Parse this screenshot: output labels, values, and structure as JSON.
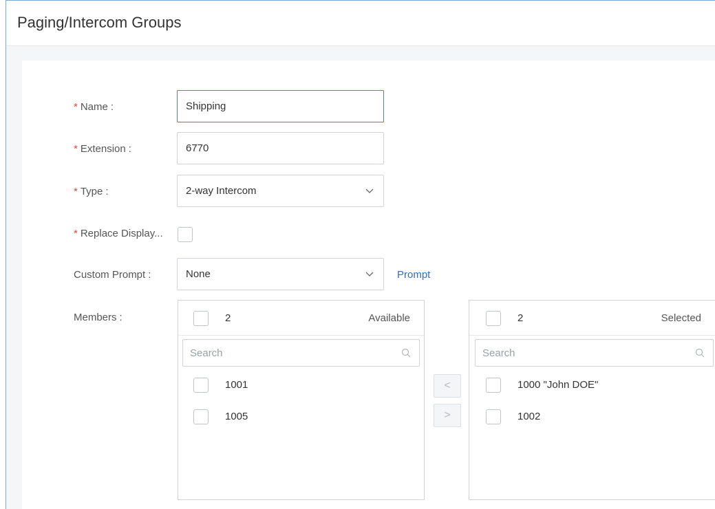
{
  "page": {
    "title": "Paging/Intercom Groups"
  },
  "form": {
    "name": {
      "label": "Name",
      "value": "Shipping",
      "required": true
    },
    "extension": {
      "label": "Extension",
      "value": "6770",
      "required": true
    },
    "type": {
      "label": "Type",
      "value": "2-way Intercom",
      "required": true
    },
    "replace_display": {
      "label": "Replace Display...",
      "required": true,
      "checked": false
    },
    "custom_prompt": {
      "label": "Custom Prompt",
      "value": "None",
      "link": "Prompt"
    },
    "members": {
      "label": "Members"
    }
  },
  "colon": ":",
  "required_mark": "*",
  "transfer": {
    "available": {
      "count": "2",
      "title": "Available",
      "search_placeholder": "Search",
      "items": [
        "1001",
        "1005"
      ]
    },
    "selected": {
      "count": "2",
      "title": "Selected",
      "search_placeholder": "Search",
      "items": [
        "1000 \"John DOE\"",
        "1002"
      ]
    },
    "move_left": "<",
    "move_right": ">"
  },
  "icons": {
    "search": "search-icon",
    "dropdown": "chevron-down-icon"
  },
  "colors": {
    "accent": "#2f6fb6",
    "required": "#e0473c",
    "focus_border": "#4a80c8"
  }
}
